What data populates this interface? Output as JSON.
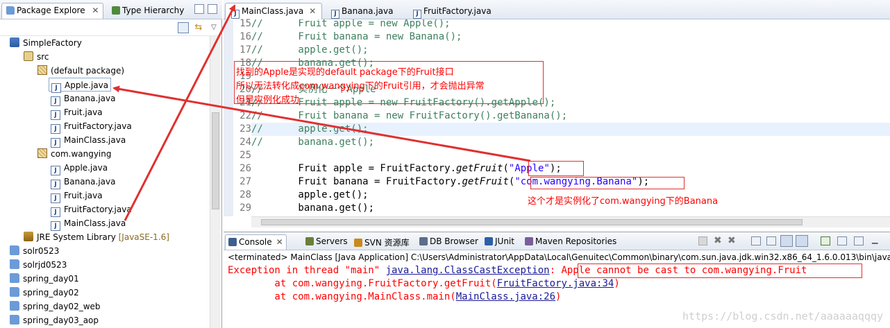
{
  "left_panel": {
    "tabs": [
      "Package Explore",
      "Type Hierarchy"
    ],
    "tree": {
      "project": "SimpleFactory",
      "src": "src",
      "default_package": "(default package)",
      "default_files": [
        "Apple.java",
        "Banana.java",
        "Fruit.java",
        "FruitFactory.java",
        "MainClass.java"
      ],
      "pkg": "com.wangying",
      "pkg_files": [
        "Apple.java",
        "Banana.java",
        "Fruit.java",
        "FruitFactory.java",
        "MainClass.java"
      ],
      "jre_label": "JRE System Library",
      "jre_version": "[JavaSE-1.6]",
      "other_projects": [
        "solr0523",
        "solrjd0523",
        "spring_day01",
        "spring_day02",
        "spring_day02_web",
        "spring_day03_aop"
      ]
    }
  },
  "editor": {
    "tabs": [
      "MainClass.java",
      "Banana.java",
      "FruitFactory.java"
    ],
    "line_numbers": [
      "15",
      "16",
      "17",
      "18",
      "19",
      "20",
      "21",
      "22",
      "23",
      "24",
      "25",
      "26",
      "27",
      "28",
      "29"
    ],
    "lines": {
      "l15": "//      Fruit apple = new Apple();",
      "l16": "//      Fruit banana = new Banana();",
      "l17": "//      apple.get();",
      "l18": "//      banana.get();",
      "l20": "//      实例化一个Apple",
      "l21": "//      Fruit apple = new FruitFactory().getApple();",
      "l22": "//      Fruit banana = new FruitFactory().getBanana();",
      "l23": "//      apple.get();",
      "l24": "//      banana.get();",
      "l26_a": "        Fruit apple = FruitFactory.",
      "l26_m": "getFruit",
      "l26_b": "(",
      "l26_s": "\"Apple\"",
      "l26_c": ");",
      "l27_a": "        Fruit banana = FruitFactory.",
      "l27_m": "getFruit",
      "l27_b": "(",
      "l27_s": "\"com.wangying.Banana\"",
      "l27_c": ");",
      "l28": "        apple.get();",
      "l29": "        banana.get();"
    }
  },
  "console": {
    "tabs": [
      "Console",
      "Servers",
      "SVN 资源库",
      "DB Browser",
      "JUnit",
      "Maven Repositories"
    ],
    "status": "<terminated> MainClass [Java Application] C:\\Users\\Administrator\\AppData\\Local\\Genuitec\\Common\\binary\\com.sun.java.jdk.win32.x86_64_1.6.0.013\\bin\\javaw.exe (",
    "line1_prefix": "Exception in thread \"main\" ",
    "line1_link": "java.lang.ClassCastException",
    "line1_suffix": ": Apple cannot be cast to com.wangying.Fruit",
    "line2_prefix": "        at com.wangying.FruitFactory.getFruit(",
    "line2_link": "FruitFactory.java:34",
    "line2_suffix": ")",
    "line3_prefix": "        at com.wangying.MainClass.main(",
    "line3_link": "MainClass.java:26",
    "line3_suffix": ")"
  },
  "annotations": {
    "note1_line1": "找到的Apple是实现的default package下的Fruit接口",
    "note1_line2": "所以无法转化成com.wangying下的Fruit引用，才会抛出异常",
    "note1_line3": "但是实例化成功",
    "note2": "这个才是实例化了com.wangying下的Banana"
  },
  "watermark": "https://blog.csdn.net/aaaaaaqqqy",
  "colors": {
    "annotation_red": "#e03030",
    "comment_green": "#3f7f5f",
    "string_blue": "#2a00ff",
    "console_error_red": "#ff0000"
  }
}
